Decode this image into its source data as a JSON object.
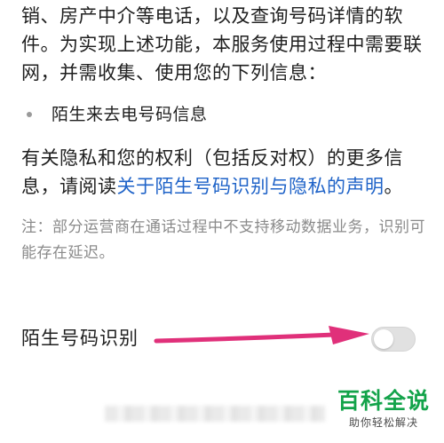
{
  "intro_text": "销、房产中介等电话，以及查询号码详情的软件。为实现上述功能，本服务使用过程中需要联网，并需收集、使用您的下列信息：",
  "bullets": [
    "陌生来去电号码信息"
  ],
  "privacy": {
    "prefix": "有关隐私和您的权利（包括反对权）的更多信息，请阅读",
    "link": "关于陌生号码识别与隐私的声明",
    "suffix": "。"
  },
  "note": "注：部分运营商在通话过程中不支持移动数据业务，识别可能存在延迟。",
  "setting": {
    "label": "陌生号码识别",
    "enabled": false
  },
  "colors": {
    "link": "#1f63c8",
    "arrow": "#e0307a",
    "watermark": "#13a34a"
  },
  "watermark": {
    "title": "百科全说",
    "subtitle": "助你轻松解决"
  }
}
